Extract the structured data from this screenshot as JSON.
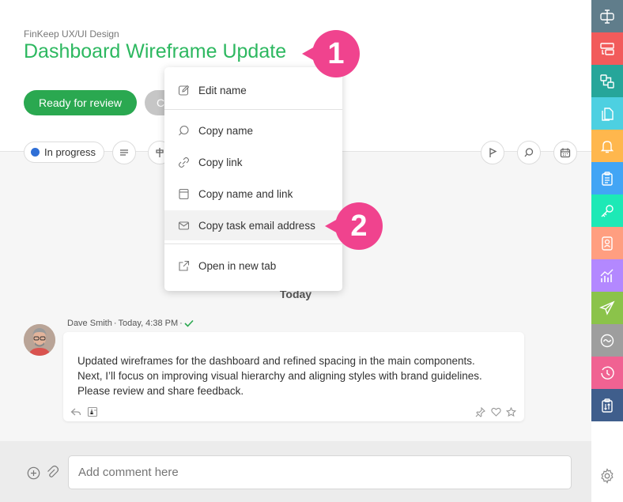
{
  "header": {
    "breadcrumb": "FinKeep UX/UI Design",
    "title": "Dashboard Wireframe Update",
    "ready_label": "Ready for review",
    "second_label": "C"
  },
  "toolbar": {
    "status_label": "In progress",
    "status_color": "#2f6fd6"
  },
  "menu": {
    "items": [
      {
        "label": "Edit name",
        "icon": "pencil-icon"
      },
      {
        "label": "Copy name",
        "icon": "search-icon"
      },
      {
        "label": "Copy link",
        "icon": "link-icon"
      },
      {
        "label": "Copy name and link",
        "icon": "card-icon"
      },
      {
        "label": "Copy task email address",
        "icon": "envelope-icon"
      },
      {
        "label": "Open in new tab",
        "icon": "external-link-icon"
      }
    ]
  },
  "callouts": {
    "first": "1",
    "second": "2"
  },
  "feed": {
    "day_label": "Today",
    "comment": {
      "author": "Dave Smith",
      "time": "Today, 4:38 PM",
      "lines": [
        "Updated wireframes for the dashboard and refined spacing in the main components.",
        "Next, I’ll focus on improving visual hierarchy and aligning styles with brand guidelines.",
        "Please review and share feedback."
      ]
    }
  },
  "composer": {
    "placeholder": "Add comment here"
  },
  "colors": {
    "title_green": "#2db860",
    "button_green": "#2aa850",
    "callout_pink": "#f0438e",
    "rail": [
      "#607d8b",
      "#f25b5b",
      "#26a69a",
      "#4dd0e1",
      "#ffb74d",
      "#42a5f5",
      "#1de9b6",
      "#ff9e80",
      "#b388ff",
      "#8bc34a",
      "#9e9e9e",
      "#f06292",
      "#3f5e8c"
    ]
  }
}
